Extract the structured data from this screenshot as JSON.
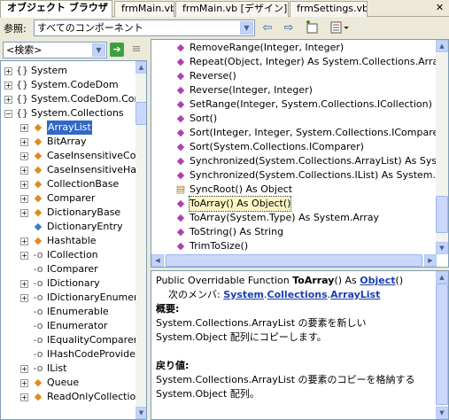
{
  "tabs": [
    {
      "label": "オブジェクト ブラウザ"
    },
    {
      "label": "frmMain.vb"
    },
    {
      "label": "frmMain.vb [デザイン]"
    },
    {
      "label": "frmSettings.vb"
    }
  ],
  "toolbar": {
    "browse_label": "参照:",
    "browse_value": "すべてのコンポーネント"
  },
  "search": {
    "placeholder": "<検索>"
  },
  "tree": [
    {
      "label": "System",
      "icon": "namespace-icon",
      "expander": "+"
    },
    {
      "label": "System.CodeDom",
      "icon": "namespace-icon",
      "expander": "+"
    },
    {
      "label": "System.CodeDom.Com",
      "icon": "namespace-icon",
      "expander": "+"
    },
    {
      "label": "System.Collections",
      "icon": "namespace-icon",
      "expander": "−"
    },
    {
      "label": "ArrayList",
      "icon": "class-icon",
      "expander": "+"
    },
    {
      "label": "BitArray",
      "icon": "class-icon",
      "expander": "+"
    },
    {
      "label": "CaseInsensitiveCo",
      "icon": "class-icon",
      "expander": "+"
    },
    {
      "label": "CaseInsensitiveHa",
      "icon": "class-icon",
      "expander": "+"
    },
    {
      "label": "CollectionBase",
      "icon": "class-icon",
      "expander": "+"
    },
    {
      "label": "Comparer",
      "icon": "class-icon",
      "expander": "+"
    },
    {
      "label": "DictionaryBase",
      "icon": "class-icon",
      "expander": "+"
    },
    {
      "label": "DictionaryEntry",
      "icon": "struct-icon",
      "expander": ""
    },
    {
      "label": "Hashtable",
      "icon": "class-icon",
      "expander": "+"
    },
    {
      "label": "ICollection",
      "icon": "interface-icon",
      "expander": "+"
    },
    {
      "label": "IComparer",
      "icon": "interface-icon",
      "expander": ""
    },
    {
      "label": "IDictionary",
      "icon": "interface-icon",
      "expander": "+"
    },
    {
      "label": "IDictionaryEnumer",
      "icon": "interface-icon",
      "expander": "+"
    },
    {
      "label": "IEnumerable",
      "icon": "interface-icon",
      "expander": ""
    },
    {
      "label": "IEnumerator",
      "icon": "interface-icon",
      "expander": ""
    },
    {
      "label": "IEqualityComparer",
      "icon": "interface-icon",
      "expander": ""
    },
    {
      "label": "IHashCodeProvide",
      "icon": "interface-icon",
      "expander": ""
    },
    {
      "label": "IList",
      "icon": "interface-icon",
      "expander": "+"
    },
    {
      "label": "Queue",
      "icon": "class-icon",
      "expander": "+"
    },
    {
      "label": "ReadOnlyCollectio",
      "icon": "class-icon",
      "expander": "+"
    }
  ],
  "members": [
    {
      "label": "RemoveRange(Integer, Integer)",
      "icon": "method-icon"
    },
    {
      "label": "Repeat(Object, Integer) As System.Collections.ArrayLi",
      "icon": "method-icon"
    },
    {
      "label": "Reverse()",
      "icon": "method-icon"
    },
    {
      "label": "Reverse(Integer, Integer)",
      "icon": "method-icon"
    },
    {
      "label": "SetRange(Integer, System.Collections.ICollection)",
      "icon": "method-icon"
    },
    {
      "label": "Sort()",
      "icon": "method-icon"
    },
    {
      "label": "Sort(Integer, Integer, System.Collections.IComparer)",
      "icon": "method-icon"
    },
    {
      "label": "Sort(System.Collections.IComparer)",
      "icon": "method-icon"
    },
    {
      "label": "Synchronized(System.Collections.ArrayList) As Syster",
      "icon": "method-icon"
    },
    {
      "label": "Synchronized(System.Collections.IList) As System.Col",
      "icon": "method-icon"
    },
    {
      "label": "SyncRoot() As Object",
      "icon": "property-icon"
    },
    {
      "label": "ToArray() As Object()",
      "icon": "method-icon"
    },
    {
      "label": "ToArray(System.Type) As System.Array",
      "icon": "method-icon"
    },
    {
      "label": "ToString() As String",
      "icon": "method-icon"
    },
    {
      "label": "TrimToSize()",
      "icon": "method-icon"
    }
  ],
  "description": {
    "sig_prefix": "Public Overridable Function ",
    "sig_name": "ToArray",
    "sig_mid": "() As ",
    "sig_type": "Object",
    "sig_suffix": "()",
    "member_of_label": "次のメンバ: ",
    "member_of_ns1": "System",
    "member_of_ns2": "Collections",
    "member_of_class": "ArrayList",
    "summary_heading": "概要:",
    "summary_line1": "System.Collections.ArrayList の要素を新しい",
    "summary_line2": "System.Object 配列にコピーします。",
    "returns_heading": "戻り値:",
    "returns_line1": "System.Collections.ArrayList の要素のコピーを格納する",
    "returns_line2": "System.Object 配列。"
  },
  "colors": {
    "selection": "#3169c6",
    "link": "#1a3fb0",
    "method_icon": "#b13db5",
    "highlight": "#fdf6c6"
  }
}
